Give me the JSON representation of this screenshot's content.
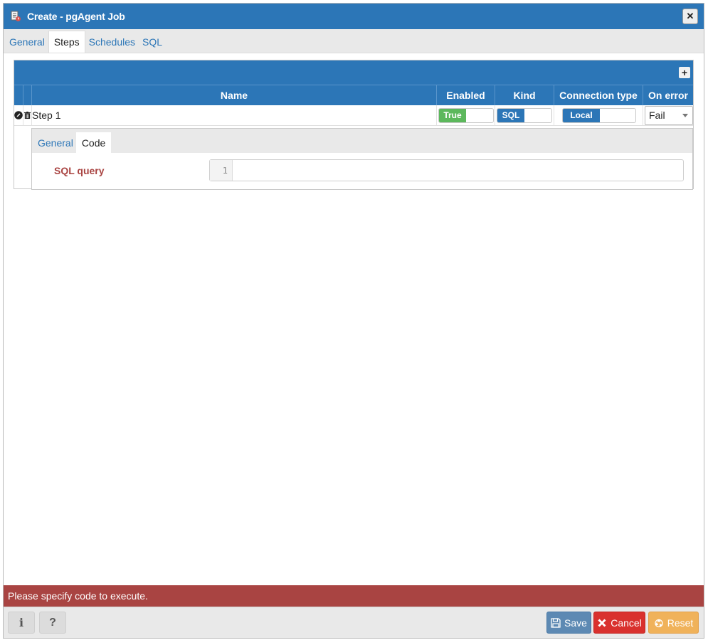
{
  "window": {
    "title": "Create - pgAgent Job"
  },
  "tabs": [
    {
      "label": "General"
    },
    {
      "label": "Steps"
    },
    {
      "label": "Schedules"
    },
    {
      "label": "SQL"
    }
  ],
  "active_tab": "Steps",
  "grid": {
    "columns": [
      "Name",
      "Enabled",
      "Kind",
      "Connection type",
      "On error"
    ],
    "rows": [
      {
        "name": "Step 1",
        "enabled": "True",
        "kind": "SQL",
        "connection_type": "Local",
        "on_error": "Fail"
      }
    ]
  },
  "step_editor": {
    "tabs": [
      {
        "label": "General"
      },
      {
        "label": "Code"
      }
    ],
    "active_tab": "Code",
    "sql_query_label": "SQL query",
    "line_number": "1"
  },
  "error_message": "Please specify code to execute.",
  "footer": {
    "info_label": "i",
    "help_label": "?",
    "save_label": "Save",
    "cancel_label": "Cancel",
    "reset_label": "Reset"
  },
  "colors": {
    "header_blue": "#2c76b7",
    "error_red": "#a94442",
    "enabled_green": "#5cb85c",
    "cancel_red": "#d9312e",
    "reset_orange": "#f0b25a"
  }
}
